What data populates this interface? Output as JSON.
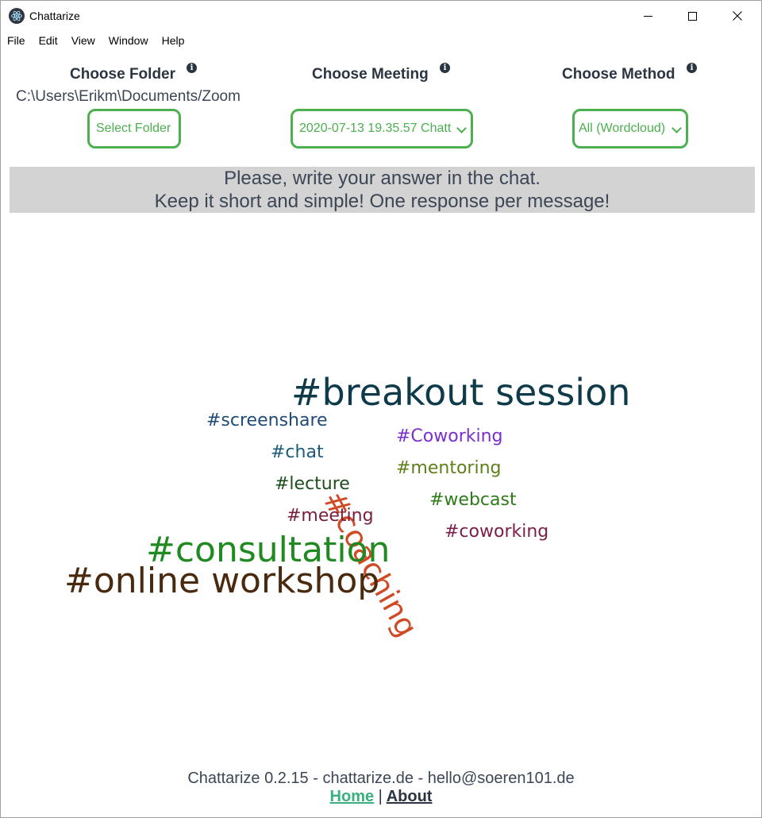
{
  "window": {
    "title": "Chattarize",
    "icon": "electron-atom-icon"
  },
  "menu": [
    "File",
    "Edit",
    "View",
    "Window",
    "Help"
  ],
  "controls": {
    "folder": {
      "heading": "Choose Folder",
      "path": "C:\\Users\\Erikm\\Documents/Zoom",
      "button_label": "Select Folder"
    },
    "meeting": {
      "heading": "Choose Meeting",
      "selected": "2020-07-13 19.35.57 Chatt"
    },
    "method": {
      "heading": "Choose Method",
      "selected": "All (Wordcloud)"
    },
    "accent_color": "#4caf50"
  },
  "banner": {
    "line1": "Please, write your answer in the chat.",
    "line2": "Keep it short and simple! One response per message!"
  },
  "wordcloud": [
    {
      "text": "#breakout session",
      "color": "#0e3a4a"
    },
    {
      "text": "#screenshare",
      "color": "#1f4a7a"
    },
    {
      "text": "#coaching",
      "color": "#d04a25"
    },
    {
      "text": "#Coworking",
      "color": "#7a2fd0"
    },
    {
      "text": "#chat",
      "color": "#1a5c7a"
    },
    {
      "text": "#mentoring",
      "color": "#5e7f1a"
    },
    {
      "text": "#lecture",
      "color": "#1d4f1d"
    },
    {
      "text": "#webcast",
      "color": "#2f7a1a"
    },
    {
      "text": "#meeting",
      "color": "#7a1f3a"
    },
    {
      "text": "#coworking",
      "color": "#7a1f4a"
    },
    {
      "text": "#consultation",
      "color": "#1f8a1f"
    },
    {
      "text": "#online workshop",
      "color": "#4a2a0e"
    }
  ],
  "footer": {
    "credits": "Chattarize 0.2.15 - chattarize.de - hello@soeren101.de",
    "home": "Home",
    "separator": "|",
    "about": "About"
  }
}
